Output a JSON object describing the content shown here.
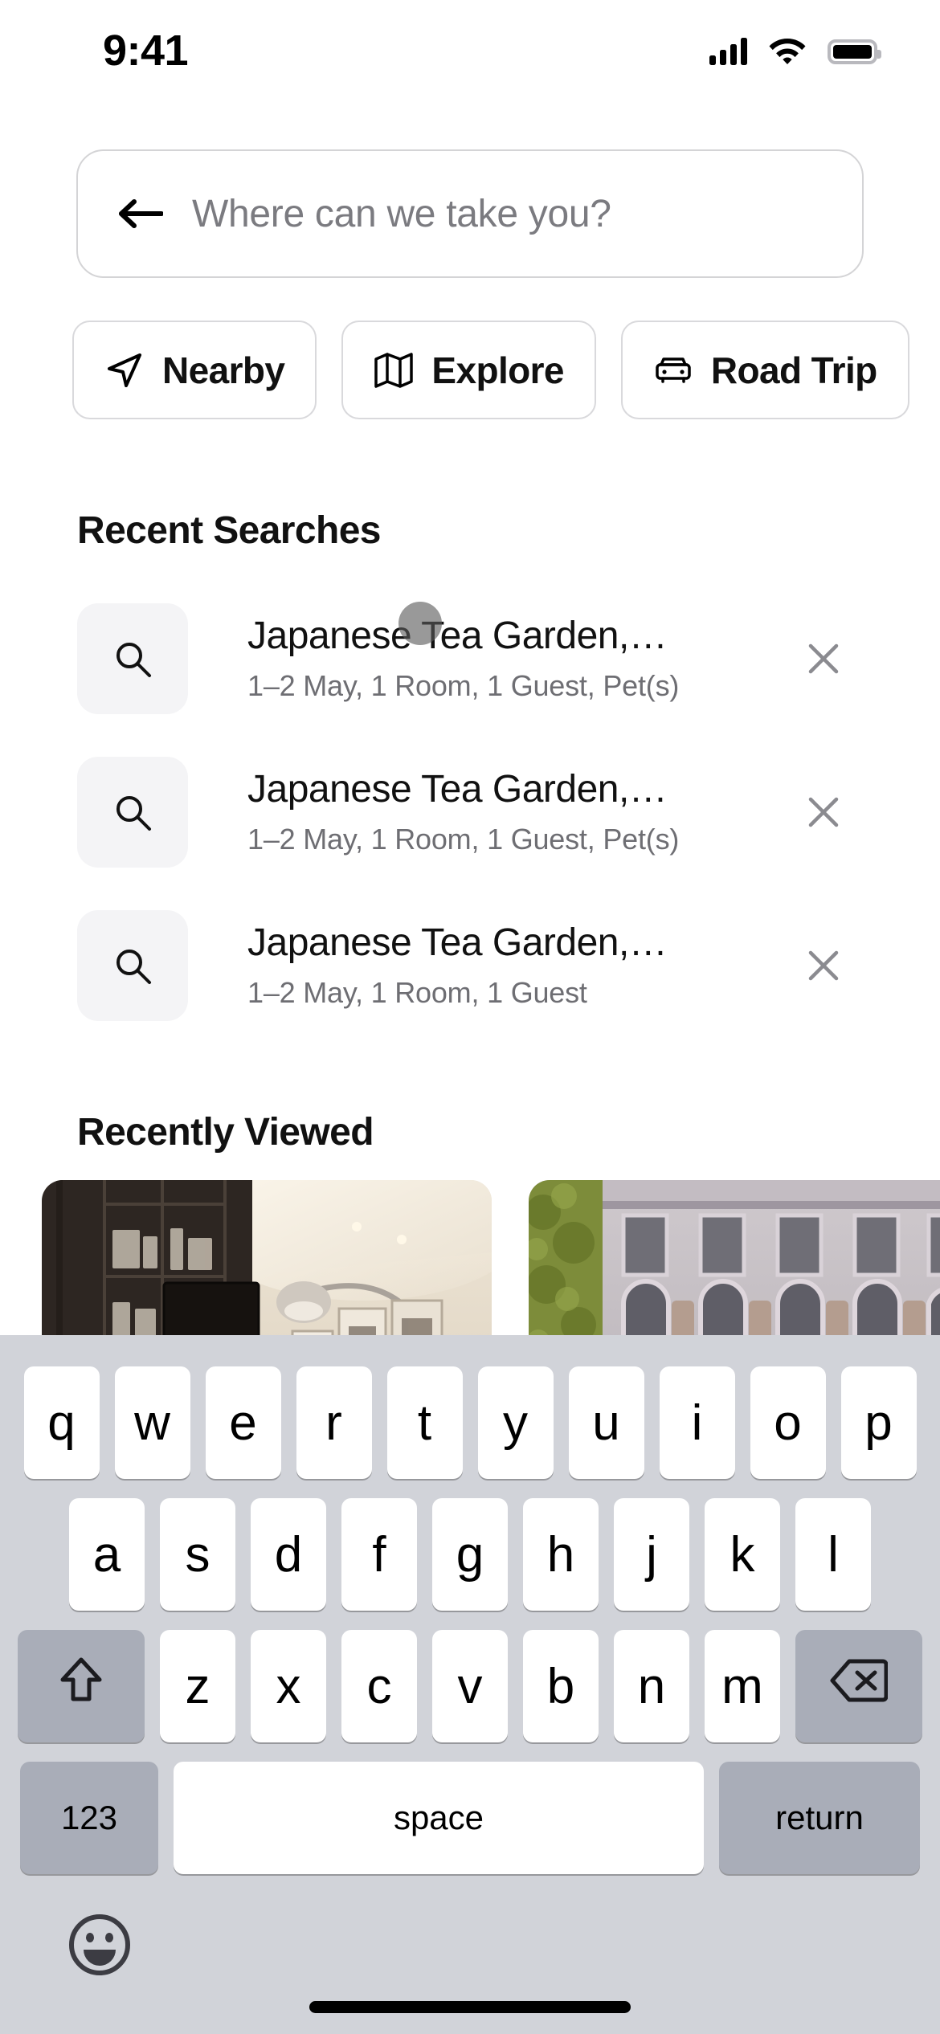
{
  "status_bar": {
    "time": "9:41",
    "signal_icon": "cellular-signal-icon",
    "wifi_icon": "wifi-icon",
    "battery_icon": "battery-full-icon"
  },
  "search": {
    "back_icon": "back-arrow-icon",
    "placeholder": "Where can we take you?",
    "value": ""
  },
  "chips": [
    {
      "label": "Nearby",
      "icon": "navigation-arrow-icon"
    },
    {
      "label": "Explore",
      "icon": "map-icon"
    },
    {
      "label": "Road Trip",
      "icon": "car-front-icon"
    }
  ],
  "recent_searches": {
    "heading": "Recent Searches",
    "items": [
      {
        "icon": "search-icon",
        "title": "Japanese Tea Garden,…",
        "subtitle": "1–2 May, 1 Room, 1 Guest, Pet(s)",
        "close_icon": "close-icon"
      },
      {
        "icon": "search-icon",
        "title": "Japanese Tea Garden,…",
        "subtitle": "1–2 May, 1 Room, 1 Guest, Pet(s)",
        "close_icon": "close-icon"
      },
      {
        "icon": "search-icon",
        "title": "Japanese Tea Garden,…",
        "subtitle": "1–2 May, 1 Room, 1 Guest",
        "close_icon": "close-icon"
      }
    ]
  },
  "recently_viewed": {
    "heading": "Recently Viewed",
    "cards": [
      {
        "alt": "hotel-lobby-interior-photo",
        "caption": ""
      },
      {
        "alt": "ornate-building-facade-photo",
        "caption": ""
      }
    ]
  },
  "keyboard": {
    "row1": [
      "q",
      "w",
      "e",
      "r",
      "t",
      "y",
      "u",
      "i",
      "o",
      "p"
    ],
    "row2": [
      "a",
      "s",
      "d",
      "f",
      "g",
      "h",
      "j",
      "k",
      "l"
    ],
    "row3": [
      "z",
      "x",
      "c",
      "v",
      "b",
      "n",
      "m"
    ],
    "shift_icon": "shift-up-arrow-icon",
    "backspace_icon": "backspace-delete-icon",
    "numbers_label": "123",
    "space_label": "space",
    "return_label": "return",
    "emoji_icon": "emoji-smiley-icon"
  },
  "colors": {
    "keyboard_bg": "#d1d3d9",
    "key_light": "#ffffff",
    "key_dark": "#a9adb8",
    "text_primary": "#111111",
    "text_secondary": "#6e6e73",
    "border": "#d9d9dc",
    "thumb_bg": "#f4f4f6"
  }
}
